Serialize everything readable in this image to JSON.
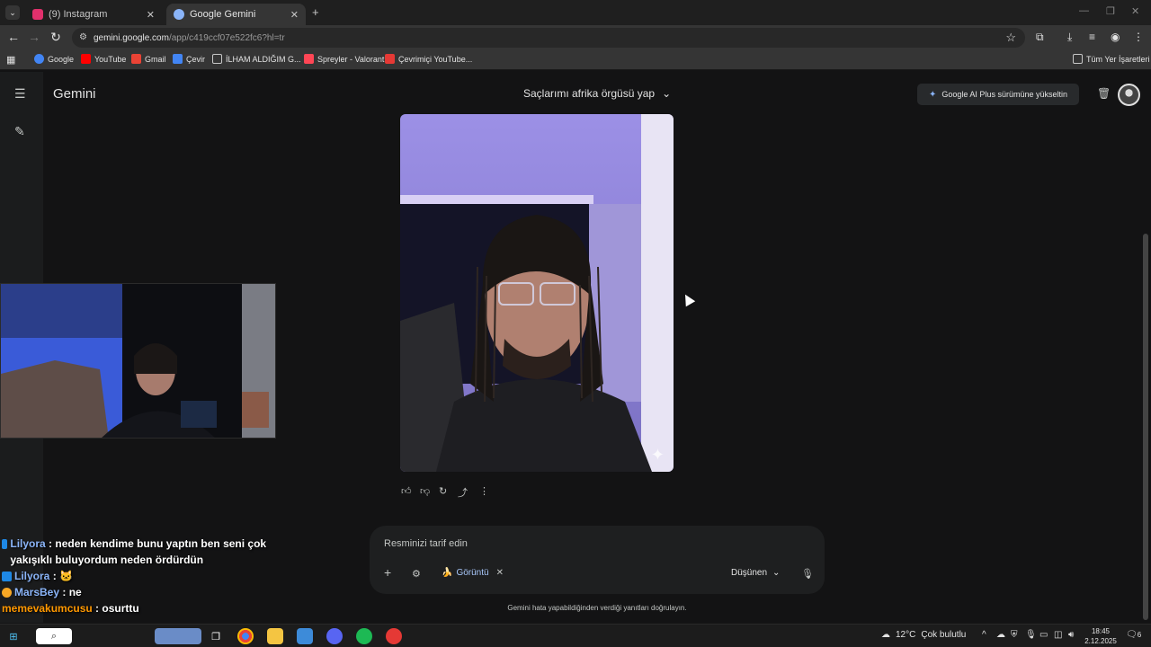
{
  "tabs": [
    {
      "label": "(9) Instagram",
      "active": false,
      "favicon_color": "#e1306c"
    },
    {
      "label": "Google Gemini",
      "active": true,
      "favicon_color": "#8ab4f8"
    }
  ],
  "address": {
    "host": "gemini.google.com",
    "path": "/app/c419ccf07e522fc6?hl=tr"
  },
  "bookmarks": [
    {
      "label": "Google",
      "icon": "google-icon",
      "color": "#4285f4"
    },
    {
      "label": "YouTube",
      "icon": "youtube-icon",
      "color": "#ff0000"
    },
    {
      "label": "Gmail",
      "icon": "gmail-icon",
      "color": "#ea4335"
    },
    {
      "label": "Çevir",
      "icon": "translate-icon",
      "color": "#4285f4"
    },
    {
      "label": "İLHAM ALDIĞIM G...",
      "icon": "folder-icon",
      "color": "#c7c7c7"
    },
    {
      "label": "Spreyler - Valorant",
      "icon": "valorant-icon",
      "color": "#ff4655"
    },
    {
      "label": "Çevrimiçi YouTube...",
      "icon": "converter-icon",
      "color": "#e53935"
    }
  ],
  "bookmarks_all": "Tüm Yer İşaretleri",
  "gemini": {
    "brand": "Gemini",
    "chat_title": "Saçlarımı afrika örgüsü yap",
    "upgrade": "Google AI Plus sürümüne yükseltin",
    "prompt_placeholder": "Resminizi tarif edin",
    "tool_chip": "Görüntü",
    "mode": "Düşünen",
    "disclaimer": "Gemini hata yapabildiğinden verdiği yanıtları doğrulayın."
  },
  "chat_overlay": [
    {
      "user": "Lilyora",
      "message": "neden kendime bunu yaptın ben seni çok yakışıklı buluyordum neden ördürdün",
      "user_color": "#8ab4f8",
      "badge_color": "#1e88e5"
    },
    {
      "user": "Lilyora",
      "message": "🐱",
      "user_color": "#8ab4f8",
      "badge_color": "#1e88e5"
    },
    {
      "user": "MarsBey",
      "message": "ne",
      "user_color": "#8ab4f8",
      "badge_color": "#f9a825"
    },
    {
      "user": "memevakumcusu",
      "message": "osurttu",
      "user_color": "#ff9800",
      "badge_color": ""
    }
  ],
  "taskbar": {
    "weather": {
      "temp": "12°C",
      "desc": "Çok bulutlu"
    },
    "time": "18:45",
    "date": "2.12.2025",
    "notifications": "6"
  }
}
